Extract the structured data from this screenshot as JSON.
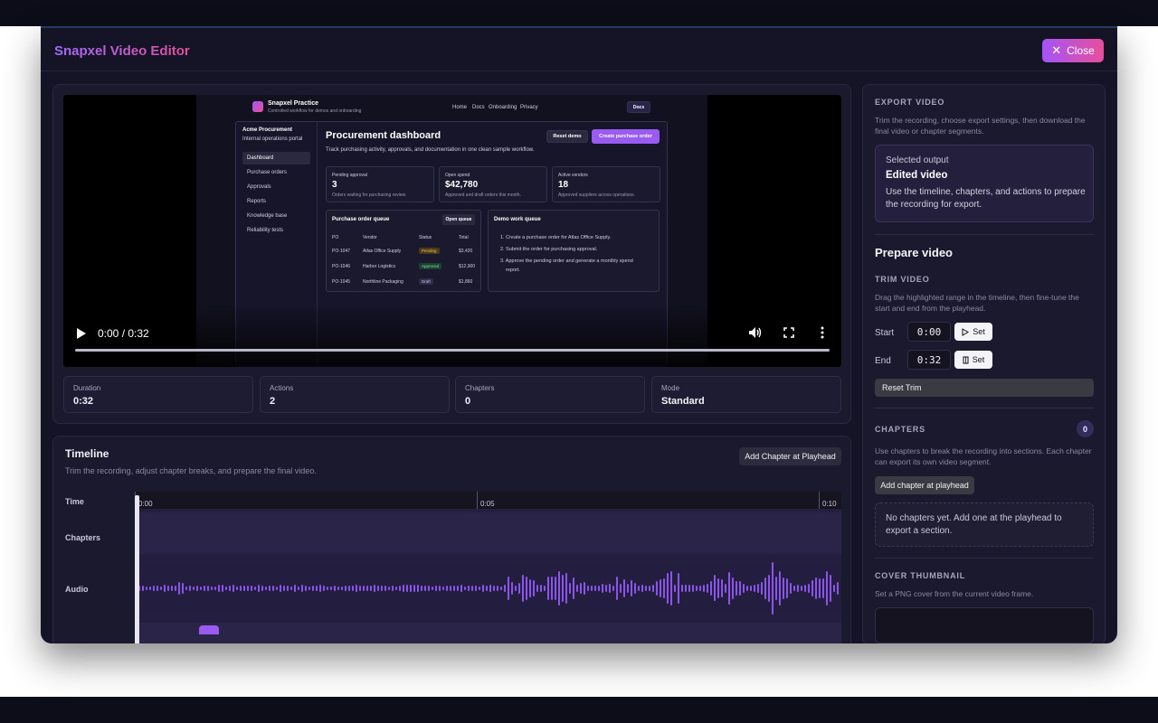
{
  "app": {
    "title": "Snapxel Video Editor",
    "close_label": "Close"
  },
  "player": {
    "time": "0:00 / 0:32",
    "progress": 0
  },
  "practice_page": {
    "brand": "Snapxel Practice",
    "brand_sub": "Controlled workflow for demos and onboarding",
    "nav": [
      "Home",
      "Docs",
      "Onboarding",
      "Privacy"
    ],
    "docs_button": "Docs",
    "org": "Acme Procurement",
    "org_sub": "Internal operations portal",
    "side_items": [
      "Dashboard",
      "Purchase orders",
      "Approvals",
      "Reports",
      "Knowledge base",
      "Reliability tests"
    ],
    "heading": "Procurement dashboard",
    "subheading": "Track purchasing activity, approvals, and documentation in one clean sample workflow.",
    "reset_demo": "Reset demo",
    "create_po": "Create purchase order",
    "kpis": [
      {
        "label": "Pending approval",
        "value": "3",
        "note": "Orders waiting for purchasing review."
      },
      {
        "label": "Open spend",
        "value": "$42,780",
        "note": "Approved and draft orders this month."
      },
      {
        "label": "Active vendors",
        "value": "18",
        "note": "Approved suppliers across operations."
      }
    ],
    "queue_title": "Purchase order queue",
    "open_queue": "Open queue",
    "queue_headers": [
      "PO",
      "Vendor",
      "Status",
      "Total"
    ],
    "queue_rows": [
      {
        "po": "PO-1047",
        "vendor": "Atlas Office Supply",
        "status": "Pending",
        "total": "$3,420"
      },
      {
        "po": "PO-1046",
        "vendor": "Harbor Logistics",
        "status": "Approved",
        "total": "$12,900"
      },
      {
        "po": "PO-1045",
        "vendor": "Northline Packaging",
        "status": "Draft",
        "total": "$1,860"
      }
    ],
    "demo_title": "Demo work queue",
    "demo_items": [
      "1. Create a purchase order for Atlas Office Supply.",
      "2. Submit the order for purchasing approval.",
      "3. Approve the pending order and generate a monthly spend",
      "report."
    ]
  },
  "stats": [
    {
      "label": "Duration",
      "value": "0:32"
    },
    {
      "label": "Actions",
      "value": "2"
    },
    {
      "label": "Chapters",
      "value": "0"
    },
    {
      "label": "Mode",
      "value": "Standard"
    }
  ],
  "timeline": {
    "title": "Timeline",
    "subtitle": "Trim the recording, adjust chapter breaks, and prepare the final video.",
    "add_chapter": "Add Chapter at Playhead",
    "rows": {
      "time": "Time",
      "chapters": "Chapters",
      "audio": "Audio"
    },
    "ticks": [
      "0:00",
      "0:05",
      "0:10"
    ]
  },
  "export": {
    "caption": "EXPORT VIDEO",
    "description": "Trim the recording, choose export settings, then download the final video or chapter segments.",
    "selected_label": "Selected output",
    "selected_value": "Edited video",
    "selected_desc": "Use the timeline, chapters, and actions to prepare the recording for export.",
    "prepare_title": "Prepare video",
    "trim_caption": "TRIM VIDEO",
    "trim_desc": "Drag the highlighted range in the timeline, then fine-tune the start and end from the playhead.",
    "start_label": "Start",
    "start_value": "0:00",
    "end_label": "End",
    "end_value": "0:32",
    "set_label": "Set",
    "reset_trim": "Reset Trim",
    "chapters_caption": "CHAPTERS",
    "chapters_count": "0",
    "chapters_desc": "Use chapters to break the recording into sections. Each chapter can export its own video segment.",
    "add_chapter": "Add chapter at playhead",
    "empty_chapters": "No chapters yet. Add one at the playhead to export a section.",
    "cover_caption": "COVER THUMBNAIL",
    "cover_desc": "Set a PNG cover from the current video frame."
  },
  "colors": {
    "accent": "#a355f7",
    "accent2": "#e84f9b",
    "wave": "#8a55e8"
  }
}
